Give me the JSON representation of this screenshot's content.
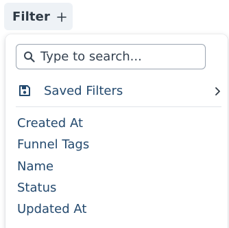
{
  "filter_button": {
    "label": "Filter",
    "icon": "plus-icon"
  },
  "dropdown": {
    "search": {
      "placeholder": "Type to search...",
      "value": "",
      "icon": "search-icon"
    },
    "saved_filters": {
      "label": "Saved Filters",
      "icon": "save-icon",
      "trailing_icon": "chevron-right-icon"
    },
    "options": [
      {
        "label": "Created At"
      },
      {
        "label": "Funnel Tags"
      },
      {
        "label": "Name"
      },
      {
        "label": "Status"
      },
      {
        "label": "Updated At"
      }
    ]
  },
  "colors": {
    "text_dark": "#2f3a45",
    "text_link": "#23496e",
    "button_bg": "#eef2f6",
    "input_border": "#9aa4b0",
    "divider": "#dfe3e8"
  }
}
